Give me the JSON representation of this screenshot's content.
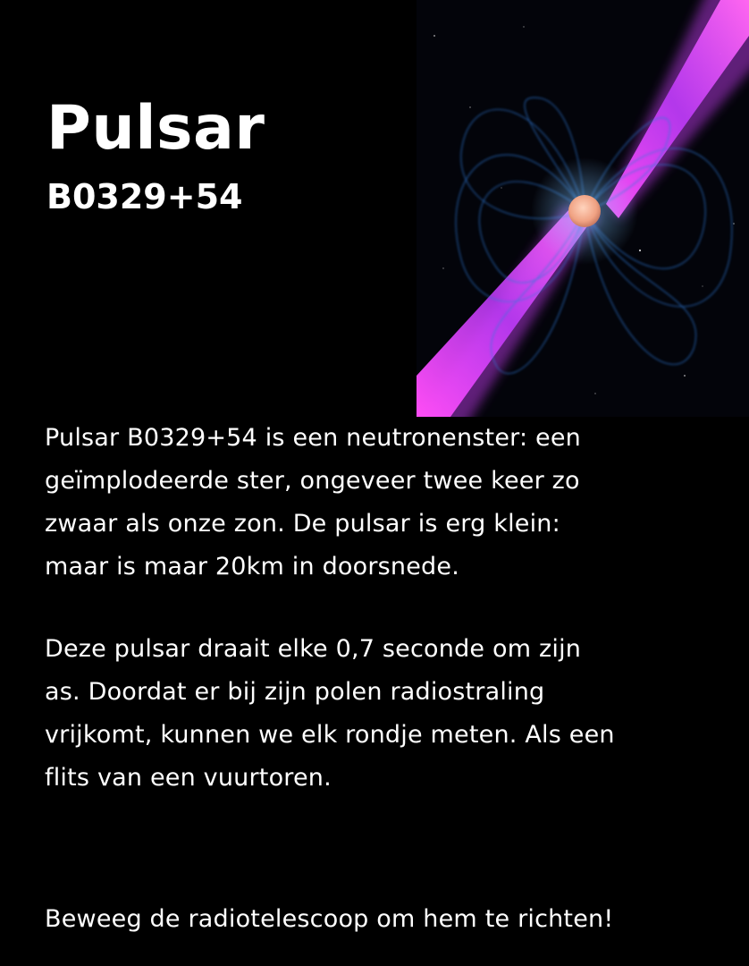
{
  "title": "Pulsar",
  "subtitle": "B0329+54",
  "paragraphs": [
    {
      "lines": [
        "Pulsar B0329+54 is een neutronenster: een",
        "geïmplodeerde ster, ongeveer twee keer zo",
        "zwaar als onze zon. De pulsar is erg klein:",
        "maar is maar 20km in doorsnede."
      ]
    },
    {
      "lines": [
        "Deze pulsar draait elke 0,7 seconde om zijn",
        "as. Doordat er bij zijn polen radiostraling",
        "vrijkomt, kunnen we elk rondje meten. Als een",
        "flits van een vuurtoren."
      ]
    }
  ],
  "instruction": "Beweeg de radiotelescoop om hem te richten!",
  "image": {
    "icon": "pulsar-illustration",
    "colors": {
      "background": "#03040a",
      "beam": "#e040ff",
      "field_lines": "#2a6fd6",
      "star": "#f2a98a"
    }
  }
}
